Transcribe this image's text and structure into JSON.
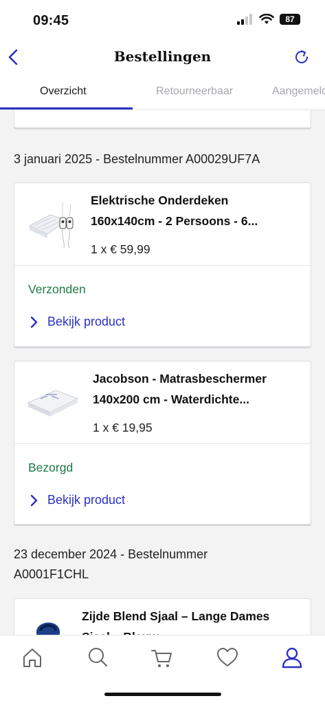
{
  "status_bar": {
    "time": "09:45",
    "battery": "87"
  },
  "header": {
    "title": "Bestellingen"
  },
  "tabs": [
    {
      "label": "Overzicht",
      "active": true
    },
    {
      "label": "Retourneerbaar",
      "active": false
    },
    {
      "label": "Aangemeld",
      "active": false
    }
  ],
  "orders": [
    {
      "heading": "3 januari 2025 - Bestelnummer A00029UF7A",
      "items": [
        {
          "name_line1": "Elektrische Onderdeken",
          "name_line2": "160x140cm - 2 Persoons - 6...",
          "quantity_price": "1 x € 59,99",
          "status": "Verzonden",
          "link": "Bekijk product"
        },
        {
          "name_line1": "Jacobson - Matrasbeschermer",
          "name_line2": "140x200 cm - Waterdichte...",
          "quantity_price": "1 x € 19,95",
          "status": "Bezorgd",
          "link": "Bekijk product"
        }
      ]
    },
    {
      "heading_line1": "23 december 2024 - Bestelnummer",
      "heading_line2": "A0001F1CHL",
      "items": [
        {
          "name_line1": "Zijde Blend Sjaal – Lange Dames",
          "name_line2": "Sjaal – Blauw"
        }
      ]
    }
  ],
  "colors": {
    "accent": "#2a2fc7",
    "status_green": "#1e7a46",
    "text": "#111111"
  }
}
